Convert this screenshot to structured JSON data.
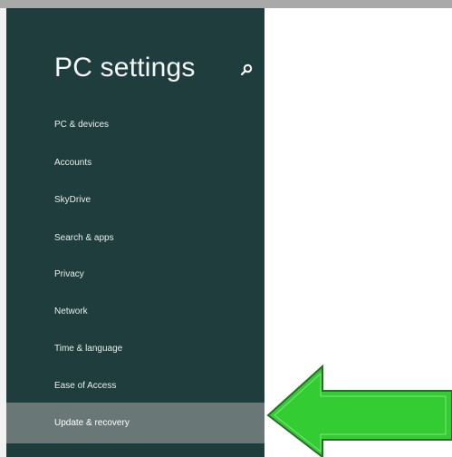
{
  "window": {
    "title": "PC settings",
    "search_icon": "search-icon",
    "panel_color": "#203d3d",
    "selected_color": "#6a7777",
    "arrow_color": "#33cc33"
  },
  "settings": {
    "items": [
      {
        "label": "PC & devices",
        "selected": false
      },
      {
        "label": "Accounts",
        "selected": false
      },
      {
        "label": "SkyDrive",
        "selected": false
      },
      {
        "label": "Search & apps",
        "selected": false
      },
      {
        "label": "Privacy",
        "selected": false
      },
      {
        "label": "Network",
        "selected": false
      },
      {
        "label": "Time & language",
        "selected": false
      },
      {
        "label": "Ease of Access",
        "selected": false
      },
      {
        "label": "Update & recovery",
        "selected": true
      }
    ]
  },
  "annotation": {
    "arrow_icon": "green-arrow-icon",
    "arrow_direction": "left"
  }
}
